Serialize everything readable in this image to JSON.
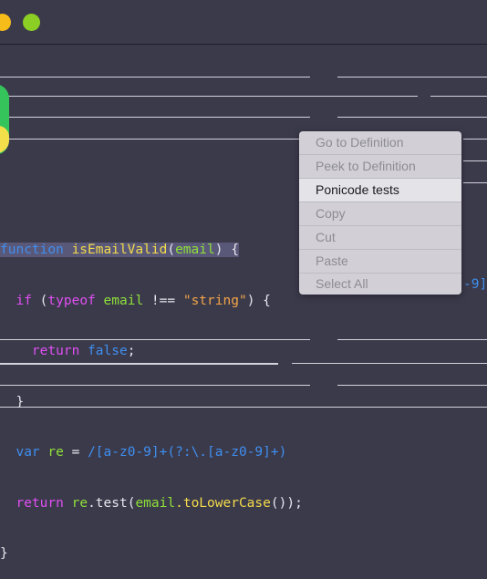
{
  "window": {
    "controls": [
      "minimize-dot",
      "maximize-dot"
    ],
    "colors": {
      "background": "#3b3a4b",
      "yellow": "#f6bd1a",
      "green": "#8bcf24"
    }
  },
  "code": {
    "line1": {
      "keyword": "function",
      "name": "isEmailValid",
      "param": "email",
      "tail": ") {"
    },
    "line2": {
      "keyword": "if",
      "open": " (",
      "typeof": "typeof",
      "ident": "email",
      "op": " !== ",
      "str": "\"string\"",
      "tail": ") {"
    },
    "line3": {
      "keyword": "return",
      "value": "false",
      "tail": ";"
    },
    "line4": {
      "text": "}"
    },
    "line5": {
      "keyword": "var",
      "ident": "re",
      "op": " = ",
      "regex": "/[a-z0-9]+(?:\\.[a-z0-9]+)"
    },
    "line6": {
      "keyword": "return",
      "obj": "re",
      "method": ".test(",
      "arg": "email",
      "call": ".toLowerCase",
      "tail": "());"
    },
    "line7": {
      "text": "}"
    },
    "regex_tail": "-9]"
  },
  "context_menu": {
    "items": [
      {
        "label": "Go to Definition",
        "enabled": false
      },
      {
        "label": "Peek to Definition",
        "enabled": false
      },
      {
        "label": "Ponicode tests",
        "enabled": true,
        "active": true
      },
      {
        "label": "Copy",
        "enabled": false
      },
      {
        "label": "Cut",
        "enabled": false
      },
      {
        "label": "Paste",
        "enabled": false
      },
      {
        "label": "Select All",
        "enabled": false
      }
    ]
  }
}
